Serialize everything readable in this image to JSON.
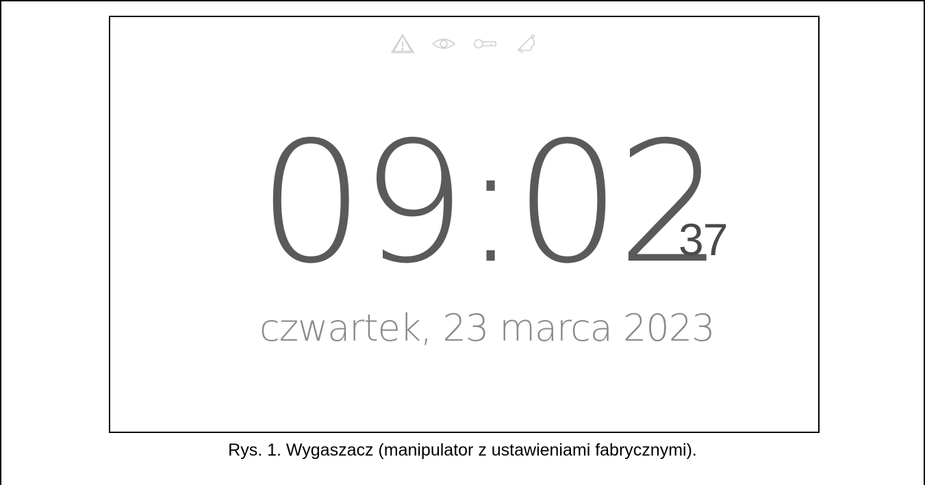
{
  "screensaver": {
    "status_icons": [
      "warning-icon",
      "eye-icon",
      "key-icon",
      "bell-icon"
    ],
    "time": "09:02",
    "seconds": "37",
    "date": "czwartek, 23 marca 2023"
  },
  "caption": "Rys. 1. Wygaszacz (manipulator z ustawieniami fabrycznymi).",
  "colors": {
    "icon_color": "#d0d0d0",
    "time_color": "#5a5a5a",
    "date_color": "#8a8a8a"
  }
}
